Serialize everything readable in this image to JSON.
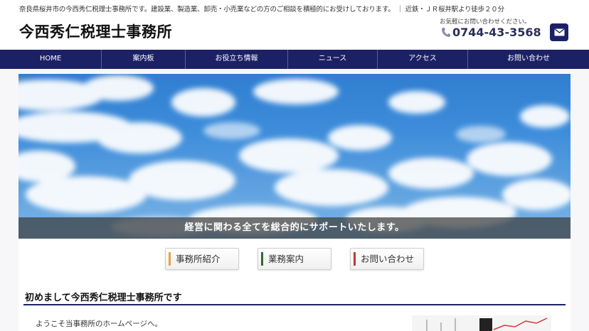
{
  "header": {
    "tagline": "奈良県桜井市の今西秀仁税理士事務所です。建設業、製造業、卸売・小売業などの方のご相談を積極的にお受けしております。 ｜ 近鉄・ＪＲ桜井駅より徒歩２０分",
    "site_title": "今西秀仁税理士事務所",
    "contact_note": "お気軽にお問い合わせください。",
    "phone": "0744-43-3568"
  },
  "nav": {
    "items": [
      "HOME",
      "案内板",
      "お役立ち情報",
      "ニュース",
      "アクセス",
      "お問い合わせ"
    ]
  },
  "hero": {
    "caption": "経営に関わる全てを総合的にサポートいたします。"
  },
  "buttons": [
    {
      "label": "事務所紹介",
      "color": "#e8a040"
    },
    {
      "label": "業務案内",
      "color": "#2e6b2e"
    },
    {
      "label": "お問い合わせ",
      "color": "#c0392b"
    }
  ],
  "content": {
    "section_title": "初めまして今西秀仁税理士事務所です",
    "welcome": "ようこそ当事務所のホームページへ。"
  },
  "colors": {
    "navy": "#1c2166"
  }
}
